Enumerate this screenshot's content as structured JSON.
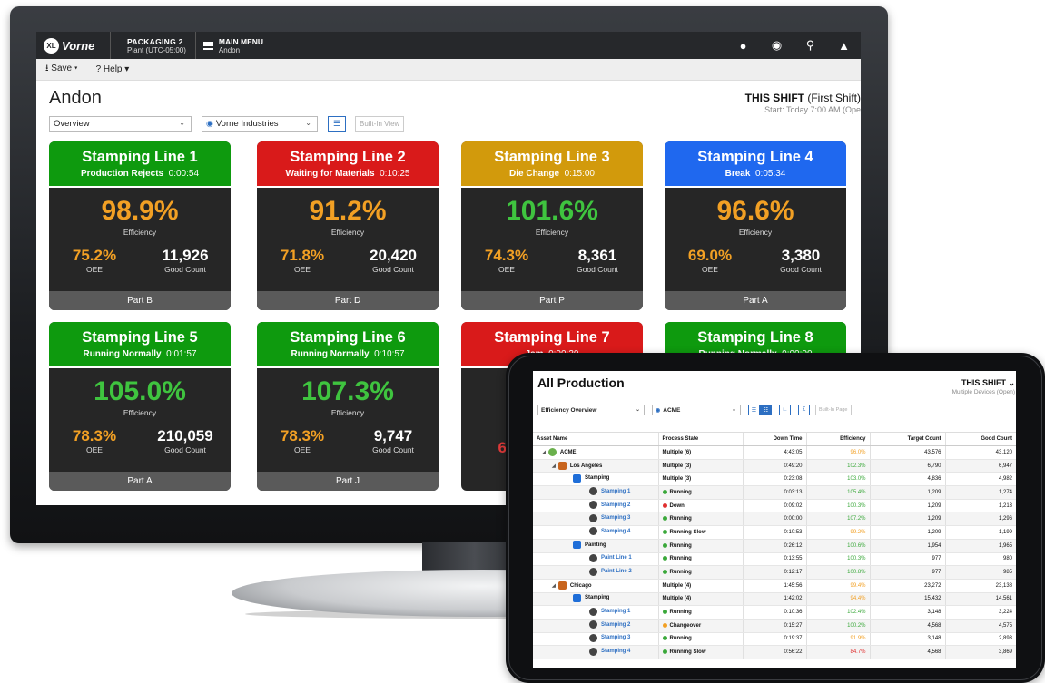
{
  "brand": {
    "logo_badge": "XL",
    "logo_text": "Vorne"
  },
  "plant": {
    "name": "PACKAGING 2",
    "timezone": "Plant (UTC-05:00)"
  },
  "menu": {
    "label": "MAIN MENU",
    "sub": "Andon"
  },
  "top_icons": [
    "user-icon",
    "globe-icon",
    "search-icon",
    "bell-icon"
  ],
  "toolbar": {
    "save": "Save",
    "help": "Help"
  },
  "page": {
    "title": "Andon",
    "shift_label": "THIS SHIFT",
    "shift_name": "(First Shift)",
    "shift_start": "Start: Today 7:00 AM (Ope",
    "view_select": "Overview",
    "scope_select": "Vorne Industries",
    "builtin_btn": "Built-In View"
  },
  "labels": {
    "efficiency": "Efficiency",
    "oee": "OEE",
    "good_count": "Good Count"
  },
  "tiles": [
    {
      "name": "Stamping Line 1",
      "state": "Production Rejects",
      "time": "0:00:54",
      "efficiency": "98.9%",
      "oee": "75.2%",
      "good": "11,926",
      "part": "Part B",
      "color": "#0e9a0e"
    },
    {
      "name": "Stamping Line 2",
      "state": "Waiting for Materials",
      "time": "0:10:25",
      "efficiency": "91.2%",
      "oee": "71.8%",
      "good": "20,420",
      "part": "Part D",
      "color": "#d91a1a"
    },
    {
      "name": "Stamping Line 3",
      "state": "Die Change",
      "time": "0:15:00",
      "efficiency": "101.6%",
      "oee": "74.3%",
      "good": "8,361",
      "part": "Part P",
      "color": "#d29a0c"
    },
    {
      "name": "Stamping Line 4",
      "state": "Break",
      "time": "0:05:34",
      "efficiency": "96.6%",
      "oee": "69.0%",
      "good": "3,380",
      "part": "Part A",
      "color": "#1f68ef"
    },
    {
      "name": "Stamping Line 5",
      "state": "Running Normally",
      "time": "0:01:57",
      "efficiency": "105.0%",
      "oee": "78.3%",
      "good": "210,059",
      "part": "Part A",
      "color": "#0e9a0e"
    },
    {
      "name": "Stamping Line 6",
      "state": "Running Normally",
      "time": "0:10:57",
      "efficiency": "107.3%",
      "oee": "78.3%",
      "good": "9,747",
      "part": "Part J",
      "color": "#0e9a0e"
    },
    {
      "name": "Stamping Line 7",
      "state": "Jam",
      "time": "0:00:30",
      "oee": "62",
      "color": "#d91a1a"
    },
    {
      "name": "Stamping Line 8",
      "state": "Running Normally",
      "time": "0:00:00",
      "color": "#0e9a0e"
    }
  ],
  "tablet": {
    "title": "All Production",
    "shift_label": "THIS SHIFT",
    "shift_sub": "Multiple Devices (Open)",
    "view_select": "Efficiency Overview",
    "scope_select": "ACME",
    "builtin_btn": "Built-In Page",
    "columns": [
      "Asset Name",
      "Process State",
      "Down Time",
      "Efficiency",
      "Target Count",
      "Good Count"
    ],
    "rows": [
      {
        "name": "ACME",
        "state": "Multiple (6)",
        "down": "4:43:05",
        "eff": "96.0%",
        "target": "43,576",
        "good": "43,120"
      },
      {
        "name": "Los Angeles",
        "state": "Multiple (3)",
        "down": "0:49:20",
        "eff": "102.3%",
        "target": "6,790",
        "good": "6,947"
      },
      {
        "name": "Stamping",
        "state": "Multiple (3)",
        "down": "0:23:08",
        "eff": "103.0%",
        "target": "4,836",
        "good": "4,982"
      },
      {
        "name": "Stamping 1",
        "state": "Running",
        "down": "0:03:13",
        "eff": "105.4%",
        "target": "1,209",
        "good": "1,274"
      },
      {
        "name": "Stamping 2",
        "state": "Down",
        "down": "0:09:02",
        "eff": "100.3%",
        "target": "1,209",
        "good": "1,213"
      },
      {
        "name": "Stamping 3",
        "state": "Running",
        "down": "0:00:00",
        "eff": "107.2%",
        "target": "1,209",
        "good": "1,296"
      },
      {
        "name": "Stamping 4",
        "state": "Running Slow",
        "down": "0:10:53",
        "eff": "99.2%",
        "target": "1,209",
        "good": "1,199"
      },
      {
        "name": "Painting",
        "state": "Running",
        "down": "0:26:12",
        "eff": "100.6%",
        "target": "1,954",
        "good": "1,965"
      },
      {
        "name": "Paint Line 1",
        "state": "Running",
        "down": "0:13:55",
        "eff": "100.3%",
        "target": "977",
        "good": "980"
      },
      {
        "name": "Paint Line 2",
        "state": "Running",
        "down": "0:12:17",
        "eff": "100.8%",
        "target": "977",
        "good": "985"
      },
      {
        "name": "Chicago",
        "state": "Multiple (4)",
        "down": "1:45:56",
        "eff": "99.4%",
        "target": "23,272",
        "good": "23,138"
      },
      {
        "name": "Stamping",
        "state": "Multiple (4)",
        "down": "1:42:02",
        "eff": "94.4%",
        "target": "15,432",
        "good": "14,561"
      },
      {
        "name": "Stamping 1",
        "state": "Running",
        "down": "0:10:36",
        "eff": "102.4%",
        "target": "3,148",
        "good": "3,224"
      },
      {
        "name": "Stamping 2",
        "state": "Changeover",
        "down": "0:15:27",
        "eff": "100.2%",
        "target": "4,568",
        "good": "4,575"
      },
      {
        "name": "Stamping 3",
        "state": "Running",
        "down": "0:19:37",
        "eff": "91.9%",
        "target": "3,148",
        "good": "2,893"
      },
      {
        "name": "Stamping 4",
        "state": "Running Slow",
        "down": "0:56:22",
        "eff": "84.7%",
        "target": "4,568",
        "good": "3,869"
      }
    ]
  }
}
